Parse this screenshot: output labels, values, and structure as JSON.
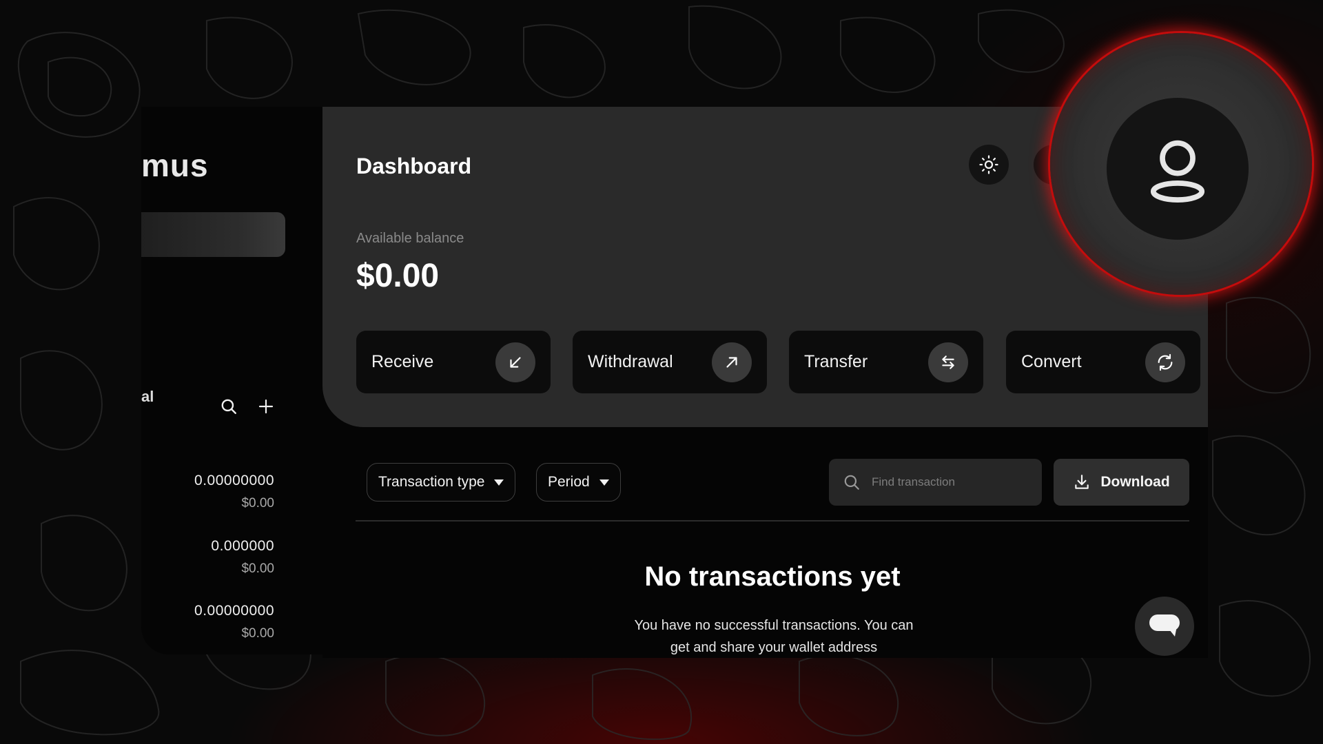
{
  "app": {
    "brand_fragment": "mus",
    "section_label_fragment": "al"
  },
  "header": {
    "title": "Dashboard",
    "theme_icon": "sun-icon",
    "profile_icon": "user-icon"
  },
  "balance": {
    "label": "Available balance",
    "value": "$0.00"
  },
  "actions": [
    {
      "label": "Receive",
      "icon": "arrow-down-left-icon"
    },
    {
      "label": "Withdrawal",
      "icon": "arrow-up-right-icon"
    },
    {
      "label": "Transfer",
      "icon": "swap-arrows-icon"
    },
    {
      "label": "Convert",
      "icon": "refresh-icon"
    }
  ],
  "filters": {
    "transaction_type": "Transaction type",
    "period": "Period"
  },
  "search": {
    "placeholder": "Find transaction"
  },
  "download_label": "Download",
  "wallets": [
    {
      "amount": "0.00000000",
      "usd": "$0.00"
    },
    {
      "amount": "0.000000",
      "usd": "$0.00"
    },
    {
      "amount": "0.00000000",
      "usd": "$0.00"
    }
  ],
  "empty_state": {
    "title": "No transactions yet",
    "message": "You have no successful transactions. You can get and share your wallet address"
  },
  "colors": {
    "accent_red": "#c40c0c",
    "card_bg": "#2a2a2a",
    "page_bg": "#050505"
  }
}
